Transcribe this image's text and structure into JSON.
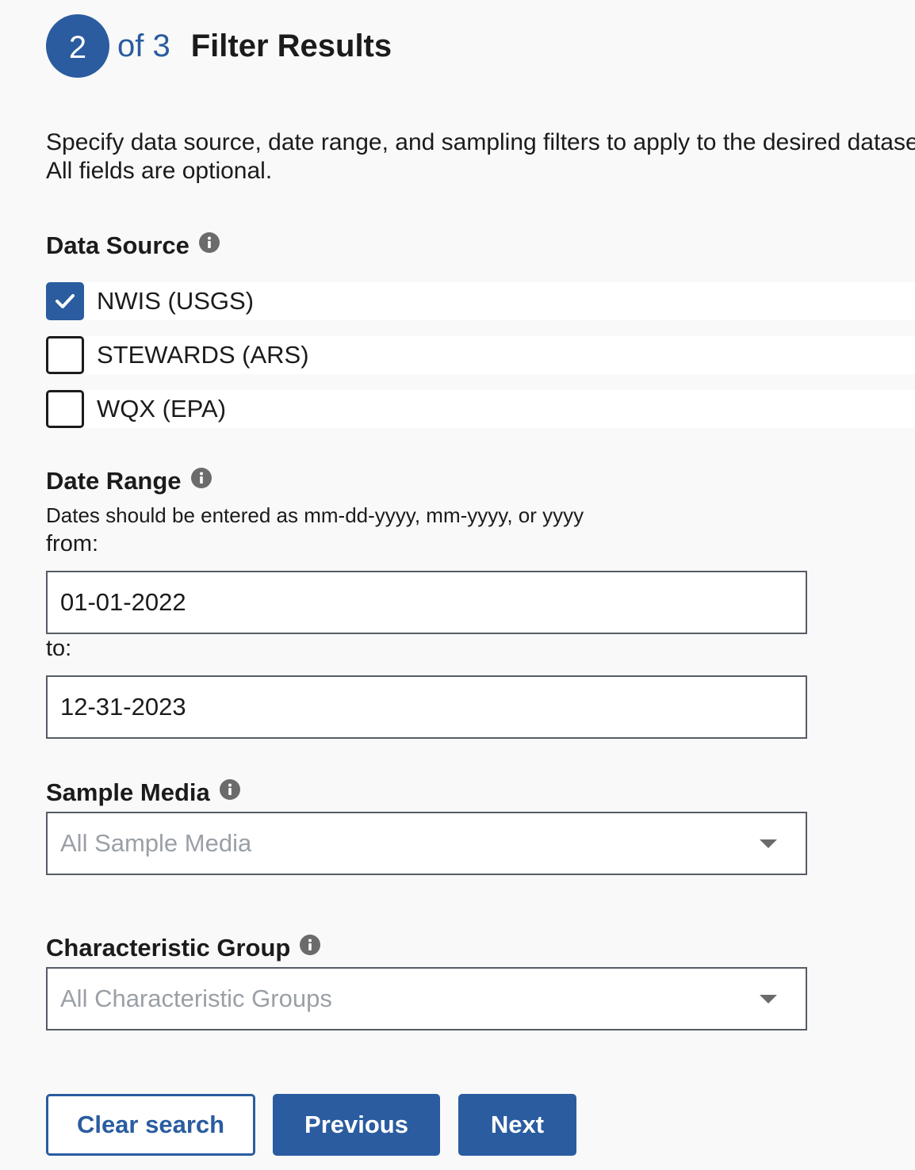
{
  "header": {
    "step_number": "2",
    "step_of": "of 3",
    "title": "Filter Results"
  },
  "intro": {
    "line1": "Specify data source, date range, and sampling filters to apply to the desired dataset.",
    "line2": "All fields are optional."
  },
  "data_source": {
    "label": "Data Source",
    "options": [
      {
        "label": "NWIS (USGS)",
        "checked": true
      },
      {
        "label": "STEWARDS (ARS)",
        "checked": false
      },
      {
        "label": "WQX (EPA)",
        "checked": false
      }
    ]
  },
  "date_range": {
    "label": "Date Range",
    "hint": "Dates should be entered as mm-dd-yyyy, mm-yyyy, or yyyy",
    "from_label": "from:",
    "from_value": "01-01-2022",
    "to_label": "to:",
    "to_value": "12-31-2023"
  },
  "sample_media": {
    "label": "Sample Media",
    "value": "All Sample Media"
  },
  "characteristic_group": {
    "label": "Characteristic Group",
    "value": "All Characteristic Groups"
  },
  "buttons": {
    "clear": "Clear search",
    "previous": "Previous",
    "next": "Next"
  },
  "colors": {
    "primary": "#2a5c9f",
    "background": "#f9f9f9",
    "placeholder": "#9aa0a6"
  },
  "icons": {
    "info": "info-icon",
    "check": "checkmark-icon",
    "dropdown": "chevron-down-icon"
  }
}
